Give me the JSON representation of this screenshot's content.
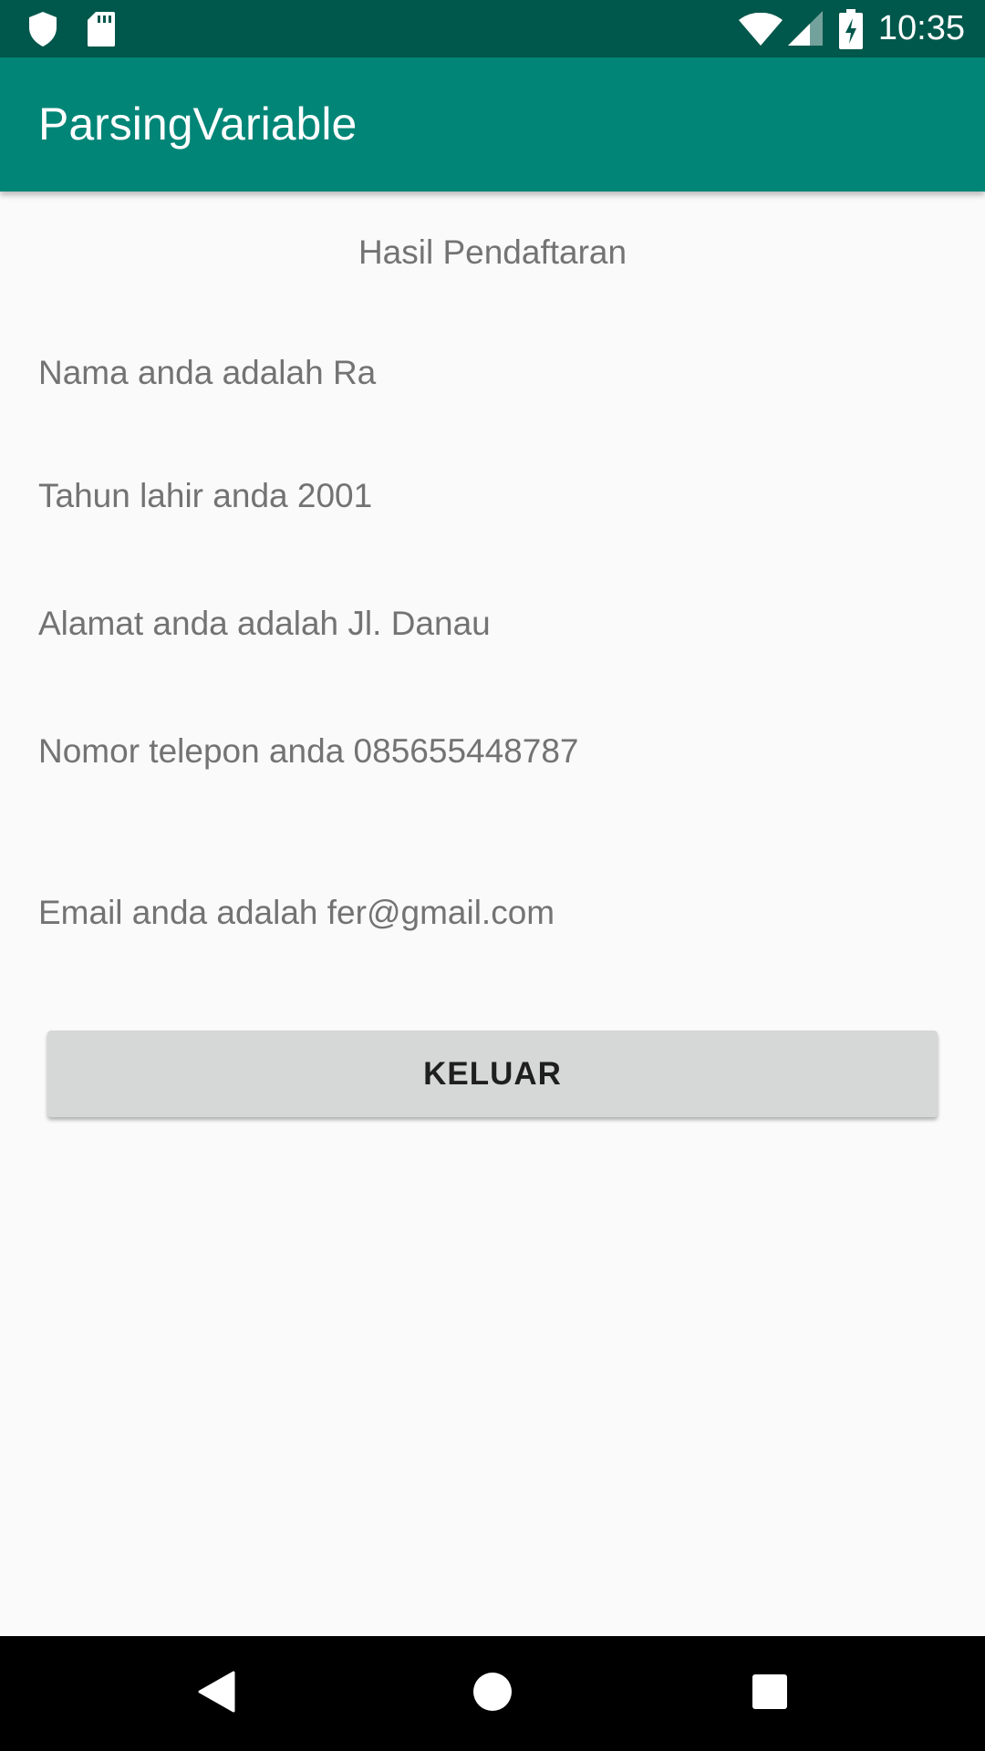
{
  "status_bar": {
    "time": "10:35",
    "icons": [
      "shield-icon",
      "sd-card-icon",
      "wifi-icon",
      "signal-icon",
      "battery-charging-icon"
    ],
    "background": "#00574b"
  },
  "app_bar": {
    "title": "ParsingVariable",
    "background": "#008577"
  },
  "content": {
    "heading": "Hasil Pendaftaran",
    "name_line": "Nama anda adalah Ra",
    "birth_year_line": "Tahun lahir anda 2001",
    "address_line": "Alamat anda adalah Jl. Danau",
    "phone_line": "Nomor telepon anda 085655448787",
    "email_line": "Email anda adalah fer@gmail.com",
    "exit_button": "KELUAR"
  },
  "nav_bar": {
    "icons": [
      "back-icon",
      "home-icon",
      "recents-icon"
    ]
  }
}
